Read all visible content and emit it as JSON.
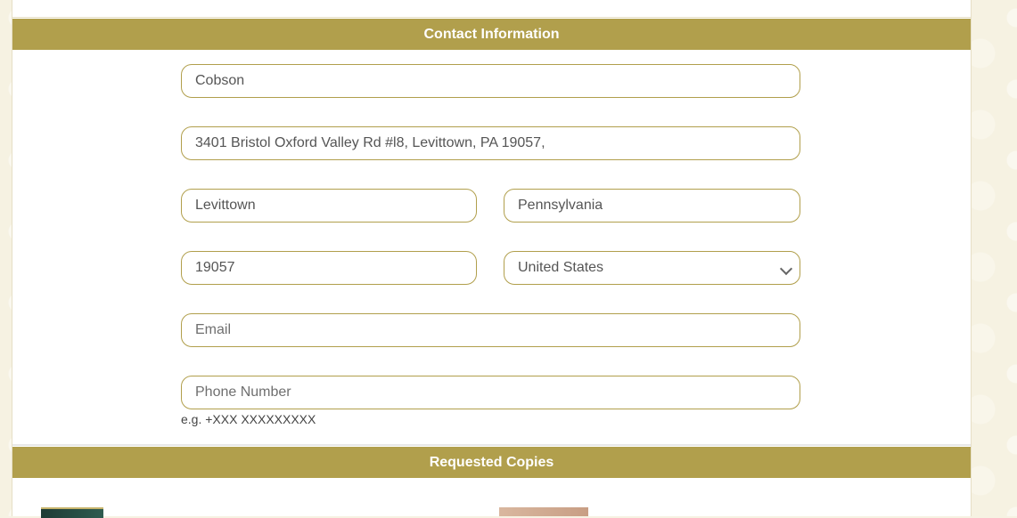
{
  "contact": {
    "title": "Contact Information",
    "last_name_value": "Cobson",
    "address_value": " 3401 Bristol Oxford Valley Rd #l8, Levittown, PA 19057,",
    "city_value": "Levittown",
    "state_value": "Pennsylvania",
    "zip_value": "19057",
    "country_value": "United States",
    "email_placeholder": "Email",
    "phone_placeholder": "Phone Number",
    "phone_hint": "e.g. +XXX XXXXXXXXX"
  },
  "requested": {
    "title": "Requested Copies"
  },
  "colors": {
    "accent": "#b19f4c",
    "page_bg": "#f6f2e2",
    "card_bg": "#ffffff"
  },
  "icons": {
    "select_chevron": "chevron-down-icon"
  }
}
